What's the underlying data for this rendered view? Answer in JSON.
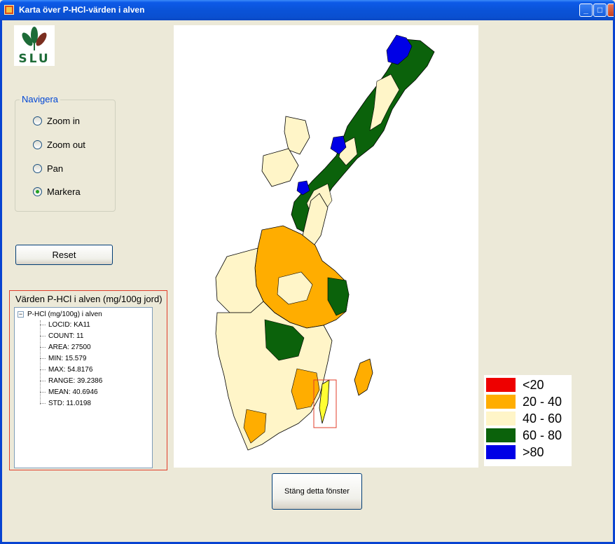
{
  "window": {
    "title": "Karta över P-HCl-värden i alven"
  },
  "logo": {
    "text": "SLU"
  },
  "navigate": {
    "legend": "Navigera",
    "options": [
      {
        "label": "Zoom in",
        "checked": false
      },
      {
        "label": "Zoom out",
        "checked": false
      },
      {
        "label": "Pan",
        "checked": false
      },
      {
        "label": "Markera",
        "checked": true
      }
    ]
  },
  "reset_label": "Reset",
  "info": {
    "title": "Värden P-HCl i alven (mg/100g jord)",
    "tree_root": "P-HCl (mg/100g) i alven",
    "items": [
      "LOCID: KA11",
      "COUNT: 11",
      "AREA: 27500",
      "MIN: 15.579",
      "MAX: 54.8176",
      "RANGE: 39.2386",
      "MEAN: 40.6946",
      "STD: 11.0198"
    ]
  },
  "legend": {
    "items": [
      {
        "label": "<20",
        "color": "#ee0000"
      },
      {
        "label": "20 - 40",
        "color": "#ffad00"
      },
      {
        "label": "40 - 60",
        "color": "#fff5c8"
      },
      {
        "label": "60 - 80",
        "color": "#0b620b"
      },
      {
        "label": ">80",
        "color": "#0000e6"
      }
    ]
  },
  "close_button_label": "Stäng detta fönster"
}
